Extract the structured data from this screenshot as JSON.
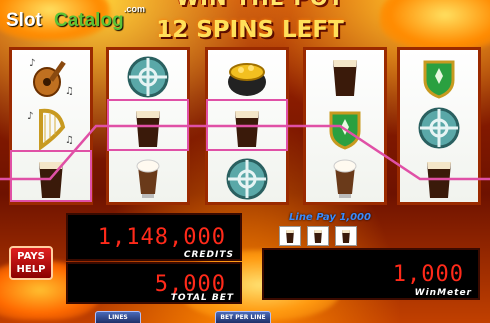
{
  "banner": {
    "top_text": "WIN THE POT",
    "spins_left": "12 SPINS LEFT"
  },
  "watermark": {
    "slot": "Slot",
    "catalog": "Catalog",
    "com": ".com"
  },
  "reels": [
    {
      "symbols": [
        "mandolin",
        "harp",
        "stout-pint"
      ]
    },
    {
      "symbols": [
        "celtic-knot-coin",
        "stout-pint",
        "irish-coffee"
      ]
    },
    {
      "symbols": [
        "gold-pot",
        "stout-pint",
        "celtic-knot-coin"
      ]
    },
    {
      "symbols": [
        "stout-pint",
        "green-shield-crest",
        "irish-coffee"
      ]
    },
    {
      "symbols": [
        "green-shield-crest",
        "celtic-knot-coin",
        "stout-pint"
      ]
    }
  ],
  "winning_line": {
    "color": "#e050a6",
    "rows": [
      2,
      1,
      1,
      1,
      2
    ]
  },
  "meters": {
    "credits_value": "1,148,000",
    "credits_label": "CREDITS",
    "total_bet_value": "5,000",
    "total_bet_label": "TOTAL BET",
    "win_value": "1,000",
    "win_label": "WinMeter"
  },
  "line_pay": {
    "label": "Line Pay 1,000",
    "symbols": [
      "stout-pint",
      "stout-pint",
      "stout-pint"
    ]
  },
  "buttons": {
    "pays_help": "PAYS HELP",
    "lines_played": "LINES PLAYED",
    "bet_per_line": "BET PER LINE"
  },
  "colors": {
    "payline": "#e050a6",
    "lcd_digits": "#ff2a1a",
    "banner_text": "#ffe05a",
    "reel_border": "#9a2a00"
  }
}
